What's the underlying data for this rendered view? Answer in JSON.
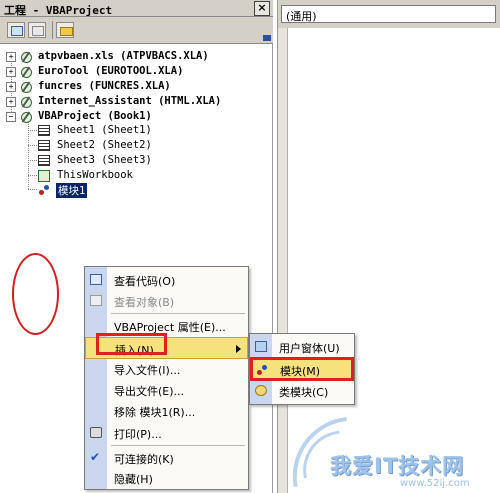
{
  "project_pane": {
    "title": "工程 - VBAProject",
    "close_glyph": "×",
    "tree": [
      {
        "label": "atpvbaen.xls (ATPVBACS.XLA)",
        "expander": "+",
        "icon": "vba-project-icon"
      },
      {
        "label": "EuroTool (EUROTOOL.XLA)",
        "expander": "+",
        "icon": "vba-project-icon"
      },
      {
        "label": "funcres (FUNCRES.XLA)",
        "expander": "+",
        "icon": "vba-project-icon"
      },
      {
        "label": "Internet_Assistant (HTML.XLA)",
        "expander": "+",
        "icon": "vba-project-icon"
      },
      {
        "label": "VBAProject (Book1)",
        "expander": "−",
        "icon": "vba-project-icon"
      },
      {
        "label": "Sheet1 (Sheet1)",
        "icon": "worksheet-icon"
      },
      {
        "label": "Sheet2 (Sheet2)",
        "icon": "worksheet-icon"
      },
      {
        "label": "Sheet3 (Sheet3)",
        "icon": "worksheet-icon"
      },
      {
        "label": "ThisWorkbook",
        "icon": "workbook-icon"
      },
      {
        "label": "模块1",
        "icon": "module-icon",
        "selected": true
      }
    ]
  },
  "code_pane": {
    "object_combo": "(通用)"
  },
  "context_menu": {
    "items": [
      {
        "label": "查看代码(O)",
        "enabled": true,
        "icon": "view-code-icon"
      },
      {
        "label": "查看对象(B)",
        "enabled": false,
        "icon": "view-object-icon"
      },
      {
        "label": "VBAProject 属性(E)...",
        "enabled": true
      },
      {
        "label": "插入(N)",
        "enabled": true,
        "has_submenu": true,
        "highlighted": true
      },
      {
        "label": "导入文件(I)...",
        "enabled": true
      },
      {
        "label": "导出文件(E)...",
        "enabled": true
      },
      {
        "label": "移除 模块1(R)...",
        "enabled": true
      },
      {
        "label": "打印(P)...",
        "enabled": true,
        "icon": "print-icon"
      },
      {
        "label": "可连接的(K)",
        "enabled": true,
        "checked": true
      },
      {
        "label": "隐藏(H)",
        "enabled": true
      }
    ]
  },
  "insert_submenu": {
    "items": [
      {
        "label": "用户窗体(U)",
        "icon": "userform-icon"
      },
      {
        "label": "模块(M)",
        "icon": "module-icon",
        "highlighted": true
      },
      {
        "label": "类模块(C)",
        "icon": "class-module-icon"
      }
    ]
  },
  "watermark": {
    "text": "我爱IT技术网",
    "subtext": "www.52ij.com"
  },
  "colors": {
    "selection": "#0a246a",
    "menu_highlight": "#f4e27c",
    "annotation_red": "#e02020",
    "menu_gutter": "#c9d6ee"
  }
}
